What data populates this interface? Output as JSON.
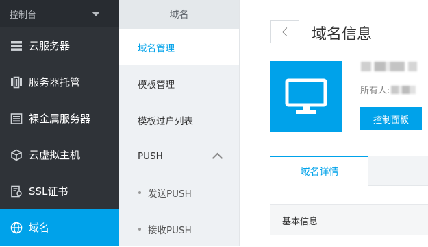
{
  "sidebar": {
    "header": "控制台",
    "items": [
      {
        "label": "云服务器",
        "icon": "server-icon"
      },
      {
        "label": "服务器托管",
        "icon": "hosting-icon"
      },
      {
        "label": "裸金属服务器",
        "icon": "bare-metal-icon"
      },
      {
        "label": "云虚拟主机",
        "icon": "cube-icon"
      },
      {
        "label": "SSL证书",
        "icon": "certificate-icon"
      },
      {
        "label": "域名",
        "icon": "globe-icon",
        "active": true
      }
    ]
  },
  "subnav": {
    "title": "域名",
    "items": [
      {
        "label": "域名管理",
        "active": true
      },
      {
        "label": "模板管理"
      },
      {
        "label": "模板过户列表"
      }
    ],
    "group": {
      "label": "PUSH",
      "children": [
        "发送PUSH",
        "接收PUSH"
      ]
    }
  },
  "main": {
    "title": "域名信息",
    "owner_label": "所有人:",
    "console_button": "控制面板",
    "tabs": [
      "域名详情"
    ],
    "section": "基本信息"
  },
  "colors": {
    "accent": "#00a2ea",
    "sidebar_bg": "#2f3338"
  }
}
